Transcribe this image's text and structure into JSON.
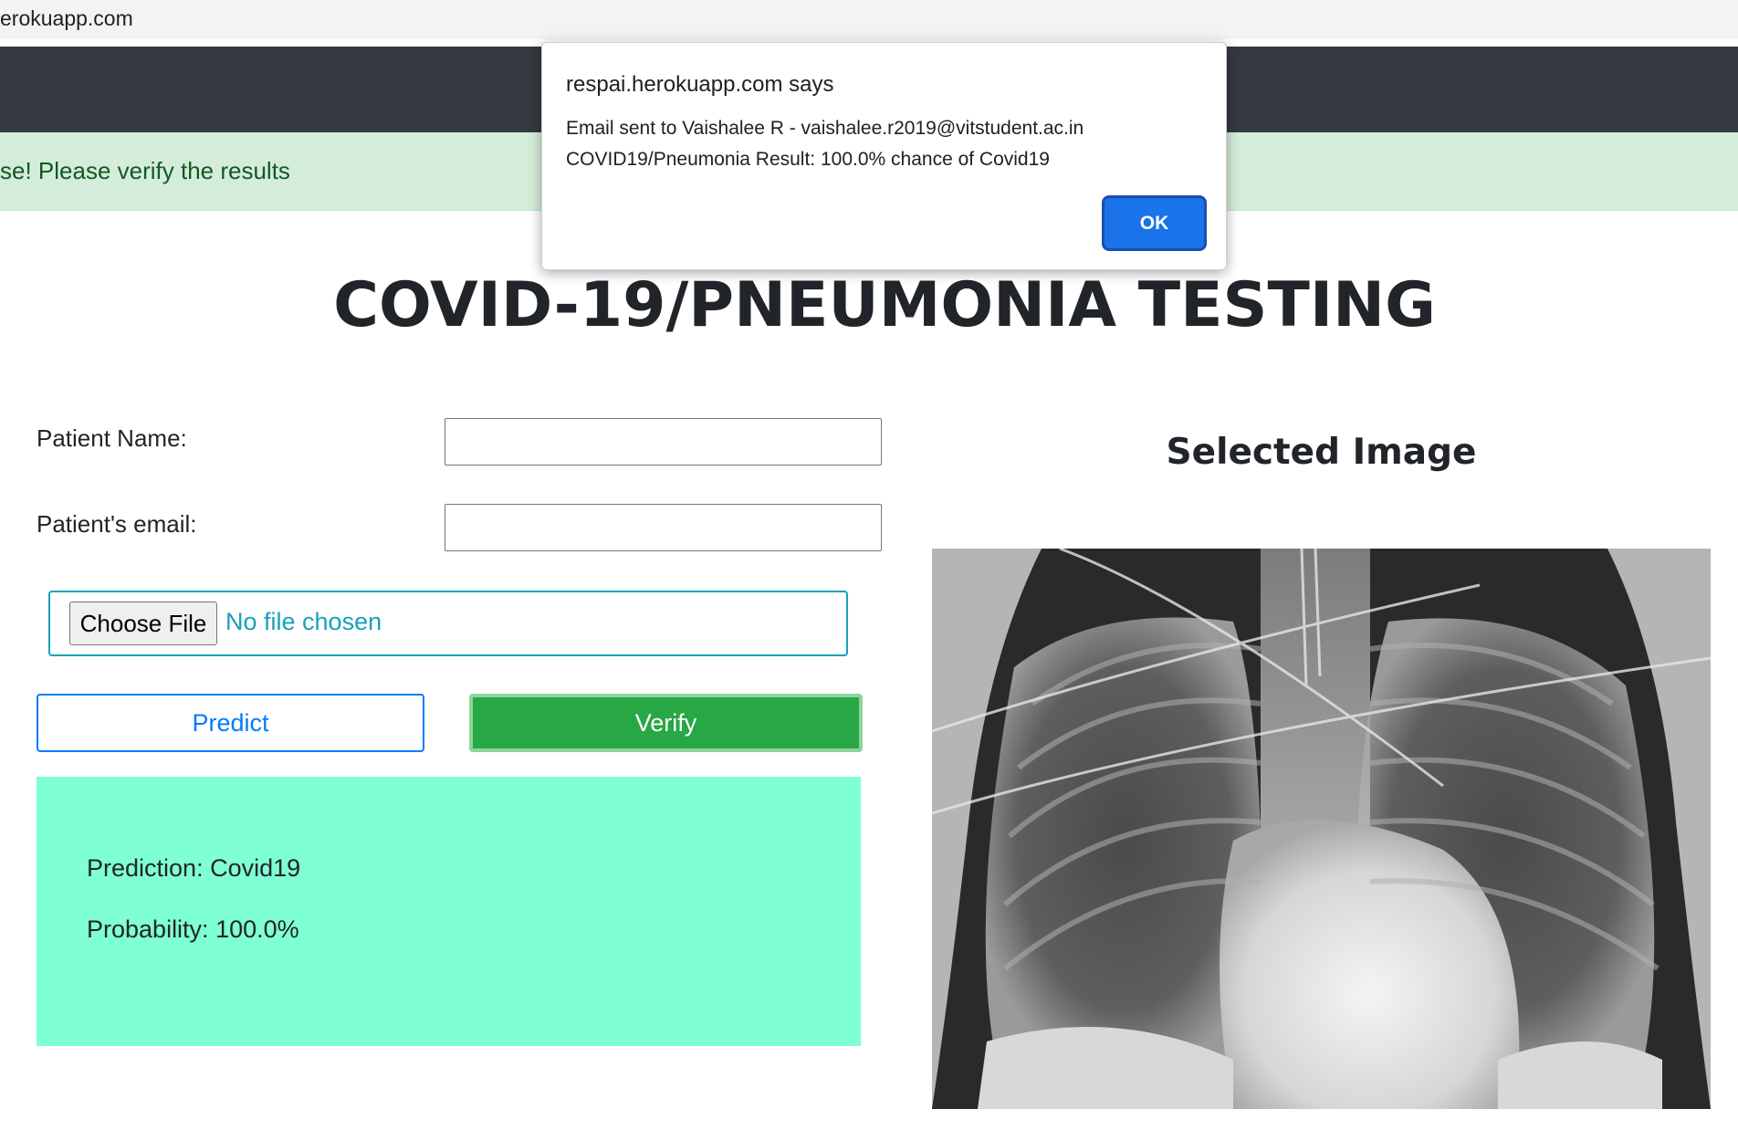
{
  "browser": {
    "url": "erokuapp.com"
  },
  "alert": {
    "message": "se! Please verify the results"
  },
  "page": {
    "title": "COVID-19/PNEUMONIA TESTING"
  },
  "form": {
    "name_label": "Patient Name:",
    "name_value": "",
    "email_label": "Patient's email:",
    "email_value": "",
    "choose_file_label": "Choose File",
    "file_status": "No file chosen",
    "predict_label": "Predict",
    "verify_label": "Verify"
  },
  "result": {
    "prediction": "Prediction: Covid19",
    "probability": "Probability: 100.0%"
  },
  "image_panel": {
    "heading": "Selected Image"
  },
  "dialog": {
    "title": "respai.herokuapp.com says",
    "line1": "Email sent to Vaishalee R - vaishalee.r2019@vitstudent.ac.in",
    "line2": "COVID19/Pneumonia Result: 100.0% chance of Covid19",
    "ok_label": "OK"
  },
  "colors": {
    "navbar": "#343a40",
    "alert_bg": "#d4edda",
    "alert_text": "#155724",
    "result_bg": "#7fffd4",
    "verify_bg": "#28a745",
    "predict_border": "#007bff",
    "ok_button": "#1a73e8"
  }
}
